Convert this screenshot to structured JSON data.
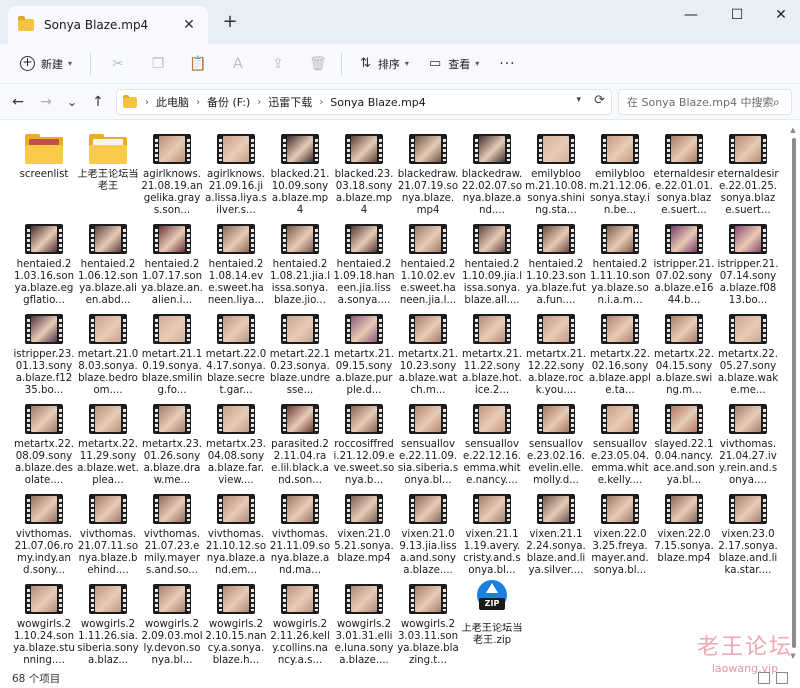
{
  "window": {
    "tab_title": "Sonya Blaze.mp4",
    "tab_close": "✕",
    "new_tab": "+",
    "minimize": "—",
    "maximize": "☐",
    "close": "✕"
  },
  "toolbar": {
    "new_label": "新建",
    "sort_label": "排序",
    "view_label": "查看",
    "more": "···"
  },
  "nav": {
    "back": "←",
    "forward": "→",
    "recent": "⌄",
    "up": "↑"
  },
  "address": {
    "crumbs": [
      "此电脑",
      "备份 (F:)",
      "迅雷下载",
      "Sonya Blaze.mp4"
    ],
    "separator": "›",
    "refresh": "⟳"
  },
  "search": {
    "placeholder": "在 Sonya Blaze.mp4 中搜索",
    "icon": "search-icon"
  },
  "files": [
    {
      "name": "screenlist",
      "type": "folder",
      "color": "#c0504a"
    },
    {
      "name": "上老王论坛当老王",
      "type": "folder",
      "color": "#f4f4f4"
    },
    {
      "name": "agirlknows.21.08.19.angelika.grays.son...",
      "type": "video",
      "color": "#b98c74"
    },
    {
      "name": "agirlknows.21.09.16.jia.lissa.liya.silver.s...",
      "type": "video",
      "color": "#c9a08a"
    },
    {
      "name": "blacked.21.10.09.sonya.blaze.mp4",
      "type": "video",
      "color": "#3b2b2b"
    },
    {
      "name": "blacked.23.03.18.sonya.blaze.mp4",
      "type": "video",
      "color": "#5a4036"
    },
    {
      "name": "blackedraw.21.07.19.sonya.blaze.mp4",
      "type": "video",
      "color": "#6b5446"
    },
    {
      "name": "blackedraw.22.02.07.sonya.blaze.and....",
      "type": "video",
      "color": "#3d3030"
    },
    {
      "name": "emilybloom.21.10.08.sonya.shining.sta...",
      "type": "video",
      "color": "#d3b29a"
    },
    {
      "name": "emilybloom.21.12.06.sonya.stay.in.be...",
      "type": "video",
      "color": "#c79c80"
    },
    {
      "name": "eternaldesire.22.01.01.sonya.blaze.suert...",
      "type": "video",
      "color": "#a97a62"
    },
    {
      "name": "eternaldesire.22.01.25.sonya.blaze.suert...",
      "type": "video",
      "color": "#b88a70"
    },
    {
      "name": "hentaied.21.03.16.sonya.blaze.eggflatio...",
      "type": "video",
      "color": "#4a2e30"
    },
    {
      "name": "hentaied.21.06.12.sonya.blaze.alien.abd...",
      "type": "video",
      "color": "#5b3f3a"
    },
    {
      "name": "hentaied.21.07.17.sonya.blaze.an.alien.i...",
      "type": "video",
      "color": "#6a3238"
    },
    {
      "name": "hentaied.21.08.14.eve.sweet.haneen.liya...",
      "type": "video",
      "color": "#8c6a5a"
    },
    {
      "name": "hentaied.21.08.21.jia.lissa.sonya.blaze.jio...",
      "type": "video",
      "color": "#7a5a4e"
    },
    {
      "name": "hentaied.21.09.18.haneen.jia.lissa.sonya....",
      "type": "video",
      "color": "#4f3a36"
    },
    {
      "name": "hentaied.21.10.02.eve.sweet.haneen.jia.l...",
      "type": "video",
      "color": "#9a7868"
    },
    {
      "name": "hentaied.21.10.09.jia.lissa.sonya.blaze.all....",
      "type": "video",
      "color": "#5e4440"
    },
    {
      "name": "hentaied.21.10.23.sonya.blaze.futa.fun....",
      "type": "video",
      "color": "#6d4a40"
    },
    {
      "name": "hentaied.21.11.10.sonya.blaze.son.i.a.m...",
      "type": "video",
      "color": "#7e5c50"
    },
    {
      "name": "istripper.21.07.02.sonya.blaze.e1644.b...",
      "type": "video",
      "color": "#7a3a68"
    },
    {
      "name": "istripper.21.07.14.sonya.blaze.f0813.bo...",
      "type": "video",
      "color": "#8c4670"
    },
    {
      "name": "istripper.23.01.13.sonya.blaze.f1235.bo...",
      "type": "video",
      "color": "#4e3442"
    },
    {
      "name": "metart.21.08.03.sonya.blaze.bedroom....",
      "type": "video",
      "color": "#c7a38c"
    },
    {
      "name": "metart.21.10.19.sonya.blaze.smiling.fo...",
      "type": "video",
      "color": "#d0ae98"
    },
    {
      "name": "metart.22.04.17.sonya.blaze.secret.gar...",
      "type": "video",
      "color": "#b99880"
    },
    {
      "name": "metart.22.10.23.sonya.blaze.undresse...",
      "type": "video",
      "color": "#c4a690"
    },
    {
      "name": "metartx.21.09.15.sonya.blaze.purple.d...",
      "type": "video",
      "color": "#8a5a78"
    },
    {
      "name": "metartx.21.10.23.sonya.blaze.watch.m...",
      "type": "video",
      "color": "#a67c66"
    },
    {
      "name": "metartx.21.11.22.sonya.blaze.hot.ice.2...",
      "type": "video",
      "color": "#b48c76"
    },
    {
      "name": "metartx.21.12.22.sonya.blaze.rock.you....",
      "type": "video",
      "color": "#c19a84"
    },
    {
      "name": "metartx.22.02.16.sonya.blaze.apple.ta...",
      "type": "video",
      "color": "#b08470"
    },
    {
      "name": "metartx.22.04.15.sonya.blaze.swing.m...",
      "type": "video",
      "color": "#a88066"
    },
    {
      "name": "metartx.22.05.27.sonya.blaze.wake.me...",
      "type": "video",
      "color": "#caa892"
    },
    {
      "name": "metartx.22.08.09.sonya.blaze.desolate....",
      "type": "video",
      "color": "#9e7a68"
    },
    {
      "name": "metartx.22.11.29.sonya.blaze.wet.plea...",
      "type": "video",
      "color": "#b89278"
    },
    {
      "name": "metartx.23.01.26.sonya.blaze.draw.me...",
      "type": "video",
      "color": "#a47e6c"
    },
    {
      "name": "metartx.23.04.08.sonya.blaze.far.view....",
      "type": "video",
      "color": "#c2a08a"
    },
    {
      "name": "parasited.22.11.04.rae.lil.black.and.son...",
      "type": "video",
      "color": "#6a3a36"
    },
    {
      "name": "roccosiffredi.21.12.09.eve.sweet.sonya.b...",
      "type": "video",
      "color": "#8a6252"
    },
    {
      "name": "sensuallove.22.11.09.sia.siberia.sonya.bl...",
      "type": "video",
      "color": "#b68670"
    },
    {
      "name": "sensuallove.22.12.16.emma.white.nancy....",
      "type": "video",
      "color": "#c39680"
    },
    {
      "name": "sensuallove.23.02.16.evelin.elle.molly.d...",
      "type": "video",
      "color": "#a67660"
    },
    {
      "name": "sensuallove.23.05.04.emma.white.kelly....",
      "type": "video",
      "color": "#cc9c86"
    },
    {
      "name": "slayed.22.10.04.nancy.ace.and.sonya.bl...",
      "type": "video",
      "color": "#b07866"
    },
    {
      "name": "vivthomas.21.04.27.ivy.rein.and.sonya....",
      "type": "video",
      "color": "#a48070"
    },
    {
      "name": "vivthomas.21.07.06.romy.indy.and.sony...",
      "type": "video",
      "color": "#927060"
    },
    {
      "name": "vivthomas.21.07.11.sonya.blaze.behind....",
      "type": "video",
      "color": "#a07868"
    },
    {
      "name": "vivthomas.21.07.23.emily.mayers.and.so...",
      "type": "video",
      "color": "#8e6a5c"
    },
    {
      "name": "vivthomas.21.10.12.sonya.blaze.and.em...",
      "type": "video",
      "color": "#b08a78"
    },
    {
      "name": "vivthomas.21.11.09.sonya.blaze.and.ma...",
      "type": "video",
      "color": "#9c7666"
    },
    {
      "name": "vixen.21.05.21.sonya.blaze.mp4",
      "type": "video",
      "color": "#7c6058"
    },
    {
      "name": "vixen.21.09.13.jia.lissa.and.sonya.blaze....",
      "type": "video",
      "color": "#8a6a5e"
    },
    {
      "name": "vixen.21.11.19.avery.cristy.and.sonya.bl...",
      "type": "video",
      "color": "#a08070"
    },
    {
      "name": "vixen.21.12.24.sonya.blaze.and.liya.silver....",
      "type": "video",
      "color": "#6e5650"
    },
    {
      "name": "vixen.22.03.25.freya.mayer.and.sonya.bl...",
      "type": "video",
      "color": "#9a7a6a"
    },
    {
      "name": "vixen.22.07.15.sonya.blaze.mp4",
      "type": "video",
      "color": "#86685c"
    },
    {
      "name": "vixen.23.02.17.sonya.blaze.and.lika.star....",
      "type": "video",
      "color": "#a48272"
    },
    {
      "name": "wowgirls.21.10.24.sonya.blaze.stunning....",
      "type": "video",
      "color": "#b48e7c"
    },
    {
      "name": "wowgirls.21.11.26.sia.siberia.sonya.blaz...",
      "type": "video",
      "color": "#c09882"
    },
    {
      "name": "wowgirls.22.09.03.molly.devon.sonya.bl...",
      "type": "video",
      "color": "#a88272"
    },
    {
      "name": "wowgirls.22.10.15.nancy.a.sonya.blaze.h...",
      "type": "video",
      "color": "#b28876"
    },
    {
      "name": "wowgirls.22.11.26.kelly.collins.nancy.a.s...",
      "type": "video",
      "color": "#bc9684"
    },
    {
      "name": "wowgirls.23.01.31.ellie.luna.sonya.blaze....",
      "type": "video",
      "color": "#ae8a7a"
    },
    {
      "name": "wowgirls.23.03.11.sonya.blaze.blazing.t...",
      "type": "video",
      "color": "#a47c6a"
    },
    {
      "name": "上老王论坛当老王.zip",
      "type": "zip",
      "color": "#1a7fe0",
      "badge": "ZIP"
    }
  ],
  "status": {
    "count": "68 个项目"
  },
  "watermark": {
    "line1": "老王论坛",
    "line2": "laowang.vip"
  }
}
